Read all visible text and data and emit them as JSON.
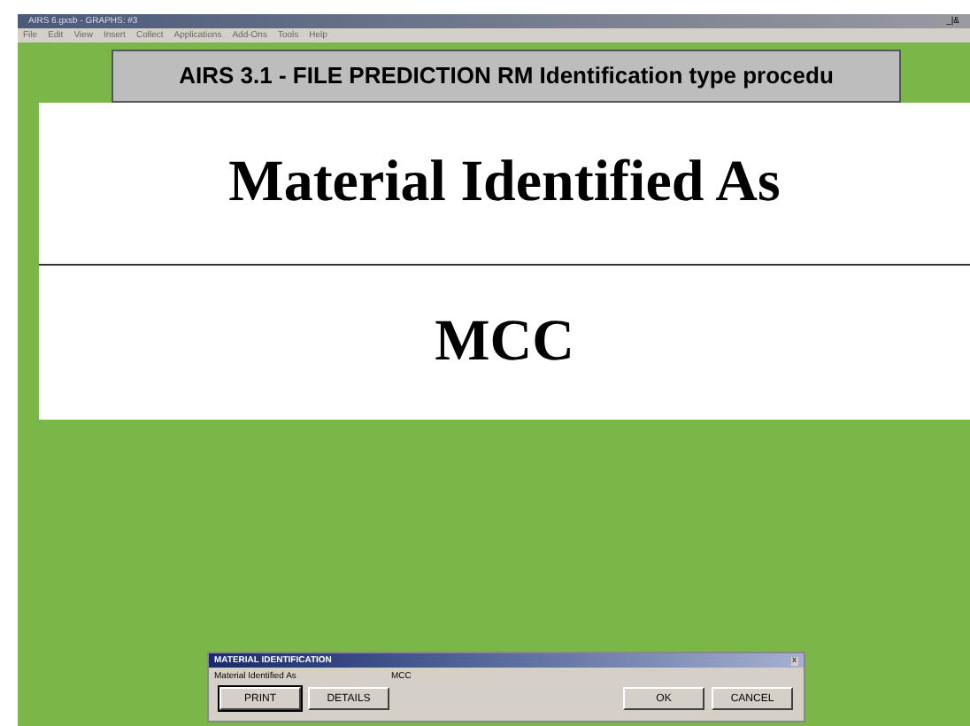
{
  "window": {
    "title": "AIRS 6.gxsb - GRAPHS: #3",
    "controls": "_|&"
  },
  "menu": [
    "File",
    "Edit",
    "View",
    "Insert",
    "Collect",
    "Applications",
    "Add-Ons",
    "Tools",
    "Help"
  ],
  "header": {
    "title": "AIRS 3.1 - FILE PREDICTION RM Identification type procedu"
  },
  "result": {
    "heading": "Material Identified As",
    "value": "MCC"
  },
  "dialog": {
    "title": "MATERIAL IDENTIFICATION",
    "close": "x",
    "label": "Material Identified As",
    "value": "MCC",
    "buttons": [
      {
        "label": "PRINT",
        "selected": true
      },
      {
        "label": "DETAILS",
        "selected": false
      },
      {
        "label": "OK",
        "selected": false
      },
      {
        "label": "CANCEL",
        "selected": false
      }
    ]
  }
}
